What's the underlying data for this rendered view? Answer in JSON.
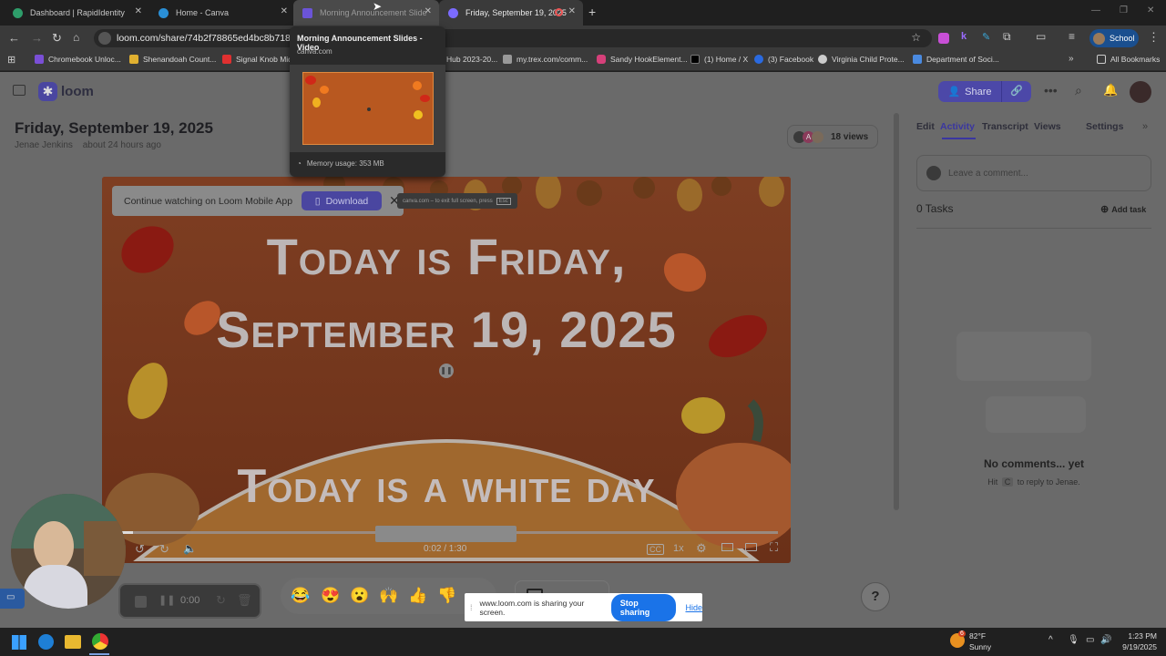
{
  "tabs": [
    {
      "title": "Dashboard | RapidIdentity"
    },
    {
      "title": "Home - Canva"
    },
    {
      "title": "Morning Announcement Slide"
    },
    {
      "title": "Friday, September 19, 2025"
    }
  ],
  "address": {
    "url": "loom.com/share/74b2f78865ed4bc8b7186f0c"
  },
  "profile_label": "School",
  "bookmarks": [
    {
      "label": "Chromebook Unloc..."
    },
    {
      "label": "Shenandoah Count..."
    },
    {
      "label": "Signal Knob Mid"
    },
    {
      "label": "Hub 2023-20..."
    },
    {
      "label": "my.trex.com/comm..."
    },
    {
      "label": "Sandy HookElement..."
    },
    {
      "label": "(1) Home / X"
    },
    {
      "label": "(3) Facebook"
    },
    {
      "label": "Virginia Child Prote..."
    },
    {
      "label": "Department of Soci..."
    },
    {
      "label": "All Bookmarks"
    }
  ],
  "tab_tooltip": {
    "title": "Morning Announcement Slides - Video",
    "domain": "canva.com",
    "memory": "Memory usage: 353 MB"
  },
  "loom": {
    "logo": "loom",
    "share_label": "Share",
    "video_title": "Friday, September 19, 2025",
    "author": "Jenae Jenkins",
    "time_ago": "about 24 hours ago",
    "views": "18 views",
    "avatar_letter": "A",
    "mobile_banner": "Continue watching on Loom Mobile App",
    "download_label": "Download",
    "fullscreen_hint": "canva.com – to exit full screen, press",
    "esc_key": "Esc",
    "slide_line1": "Today is Friday,",
    "slide_line2": "September 19, 2025",
    "slide_line3": "Today is a white day",
    "time_display": "0:02 / 1:30",
    "speed": "1x",
    "side_tabs": [
      "Edit",
      "Activity",
      "Transcript",
      "Views",
      "Settings"
    ],
    "comment_placeholder": "Leave a comment...",
    "tasks_label": "0 Tasks",
    "add_task": "Add task",
    "no_comments": "No comments... yet",
    "hint_prefix": "Hit",
    "hint_key": "C",
    "hint_suffix": "to reply to Jenae.",
    "recorder_time": "0:00",
    "help": "?"
  },
  "sharing": {
    "text": "www.loom.com is sharing your screen.",
    "stop": "Stop sharing",
    "hide": "Hide"
  },
  "taskbar": {
    "temp": "82°F",
    "weather": "Sunny",
    "weather_badge": "6",
    "time": "1:23 PM",
    "date": "9/19/2025"
  },
  "reactions": [
    "😂",
    "😍",
    "😮",
    "🙌",
    "👍",
    "👎"
  ],
  "colors": {
    "accent": "#625df5",
    "page_bg": "#6a6a6a",
    "slide_bg": "#7a3a20"
  }
}
